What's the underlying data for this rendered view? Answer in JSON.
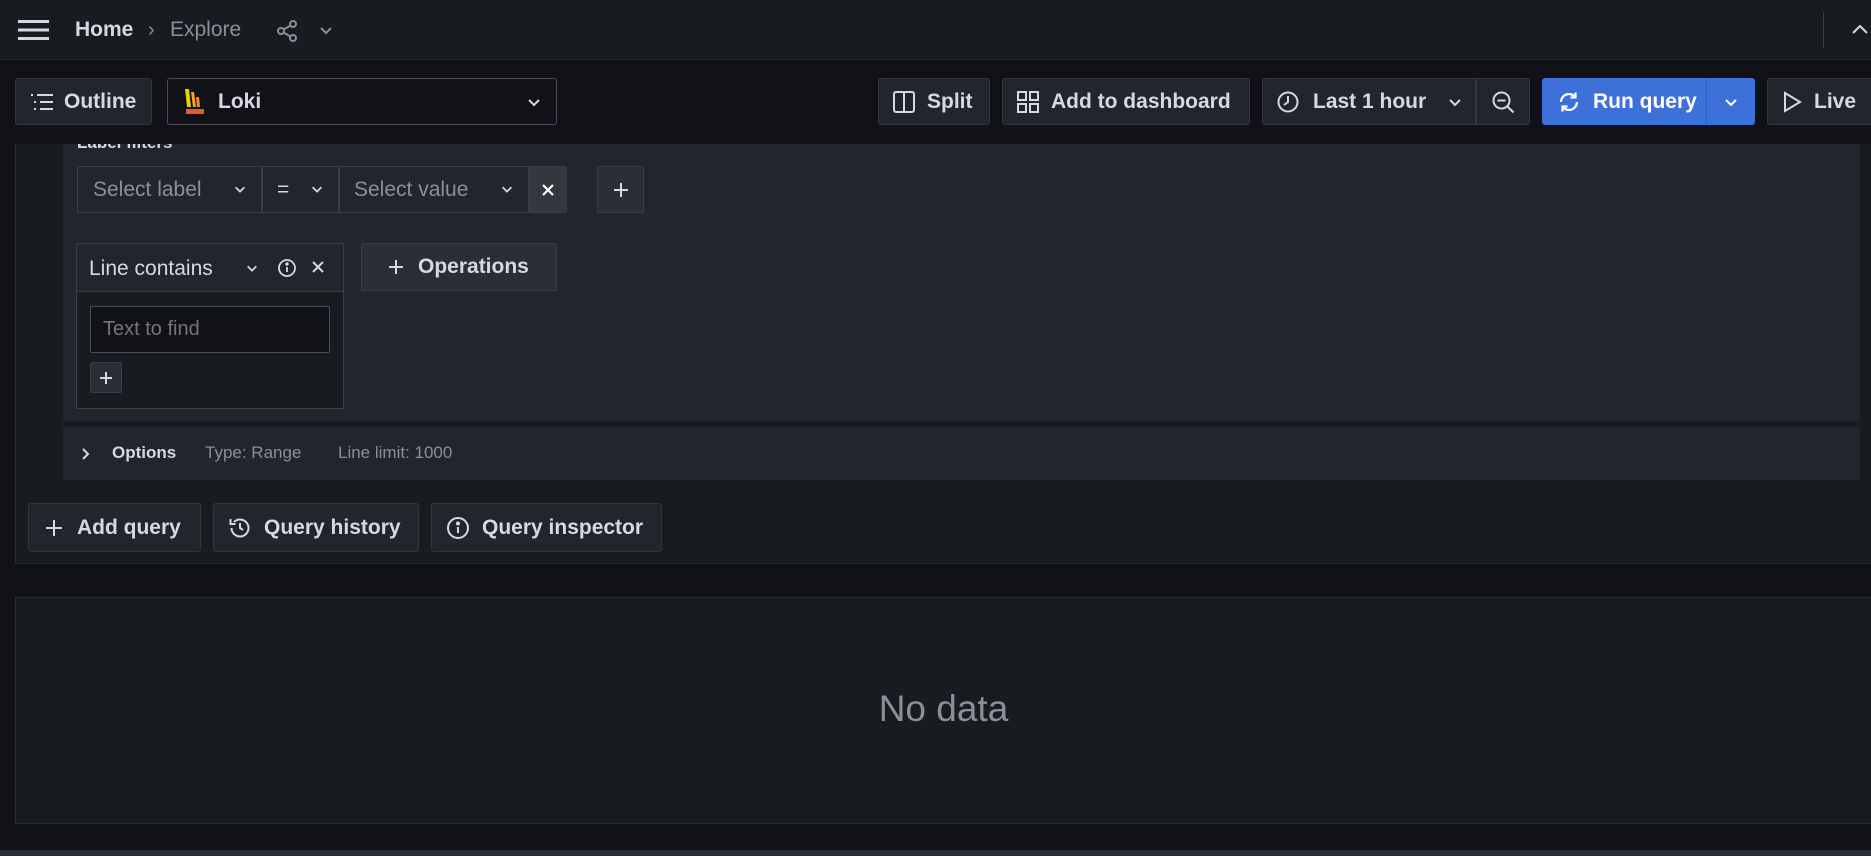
{
  "breadcrumb": {
    "home": "Home",
    "separator": "›",
    "current": "Explore"
  },
  "toolbar": {
    "outline": "Outline",
    "datasource": "Loki",
    "split": "Split",
    "add_to_dashboard": "Add to dashboard",
    "time_range": "Last 1 hour",
    "run_query": "Run query",
    "live": "Live"
  },
  "query_builder": {
    "label_filters_title": "Label filters",
    "select_label_placeholder": "Select label",
    "operator": "=",
    "select_value_placeholder": "Select value",
    "operation_card_title": "Line contains",
    "text_to_find_placeholder": "Text to find",
    "operations_button": "Operations"
  },
  "options": {
    "label": "Options",
    "type": "Type: Range",
    "line_limit": "Line limit: 1000"
  },
  "query_actions": {
    "add_query": "Add query",
    "query_history": "Query history",
    "query_inspector": "Query inspector"
  },
  "results": {
    "empty_text": "No data"
  },
  "colors": {
    "background": "#111217",
    "panel": "#181b1f",
    "secondary": "#22252b",
    "primary": "#3d71d9",
    "text": "#d8d9e0",
    "muted": "#8e8e99"
  },
  "icons": [
    "menu-icon",
    "chevron-right-icon",
    "share-icon",
    "chevron-down-icon",
    "chevron-up-icon",
    "list-icon",
    "loki-logo-icon",
    "split-icon",
    "grid-icon",
    "clock-icon",
    "zoom-out-icon",
    "refresh-icon",
    "play-icon",
    "close-icon",
    "plus-icon",
    "info-icon",
    "history-icon"
  ]
}
